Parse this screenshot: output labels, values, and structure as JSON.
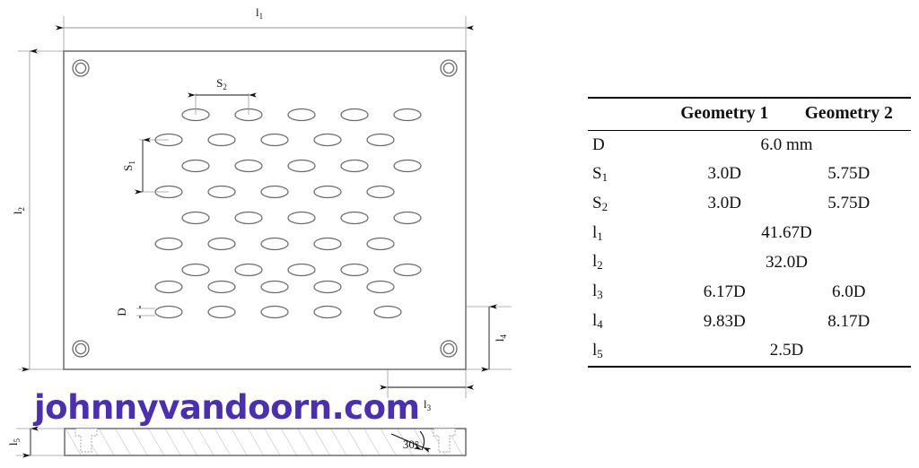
{
  "drawing": {
    "labels": {
      "l1": "l₁",
      "l2": "l₂",
      "l3": "l₃",
      "l4": "l₄",
      "l5": "l₅",
      "s1": "S₁",
      "s2": "S₂",
      "d": "D",
      "angle": "30°"
    },
    "plate": {
      "hole_rows": 9,
      "holes_per_row": 5,
      "corner_bolt_holes": 4
    }
  },
  "watermark": {
    "text": "johnnyvandoorn.com",
    "color": "#4B2FAF"
  },
  "table": {
    "columns": [
      "",
      "Geometry 1",
      "Geometry 2"
    ],
    "rows": [
      {
        "label": "D",
        "label_base": "D",
        "label_sub": "",
        "span": true,
        "value": "6.0 mm",
        "g1": "6.0 mm",
        "g2": ""
      },
      {
        "label": "S₁",
        "label_base": "S",
        "label_sub": "1",
        "span": false,
        "value": "",
        "g1": "3.0D",
        "g2": "5.75D"
      },
      {
        "label": "S₂",
        "label_base": "S",
        "label_sub": "2",
        "span": false,
        "value": "",
        "g1": "3.0D",
        "g2": "5.75D"
      },
      {
        "label": "l₁",
        "label_base": "l",
        "label_sub": "1",
        "span": true,
        "value": "41.67D",
        "g1": "41.67D",
        "g2": ""
      },
      {
        "label": "l₂",
        "label_base": "l",
        "label_sub": "2",
        "span": true,
        "value": "32.0D",
        "g1": "32.0D",
        "g2": ""
      },
      {
        "label": "l₃",
        "label_base": "l",
        "label_sub": "3",
        "span": false,
        "value": "",
        "g1": "6.17D",
        "g2": "6.0D"
      },
      {
        "label": "l₄",
        "label_base": "l",
        "label_sub": "4",
        "span": false,
        "value": "",
        "g1": "9.83D",
        "g2": "8.17D"
      },
      {
        "label": "l₅",
        "label_base": "l",
        "label_sub": "5",
        "span": true,
        "value": "2.5D",
        "g1": "2.5D",
        "g2": ""
      }
    ]
  }
}
